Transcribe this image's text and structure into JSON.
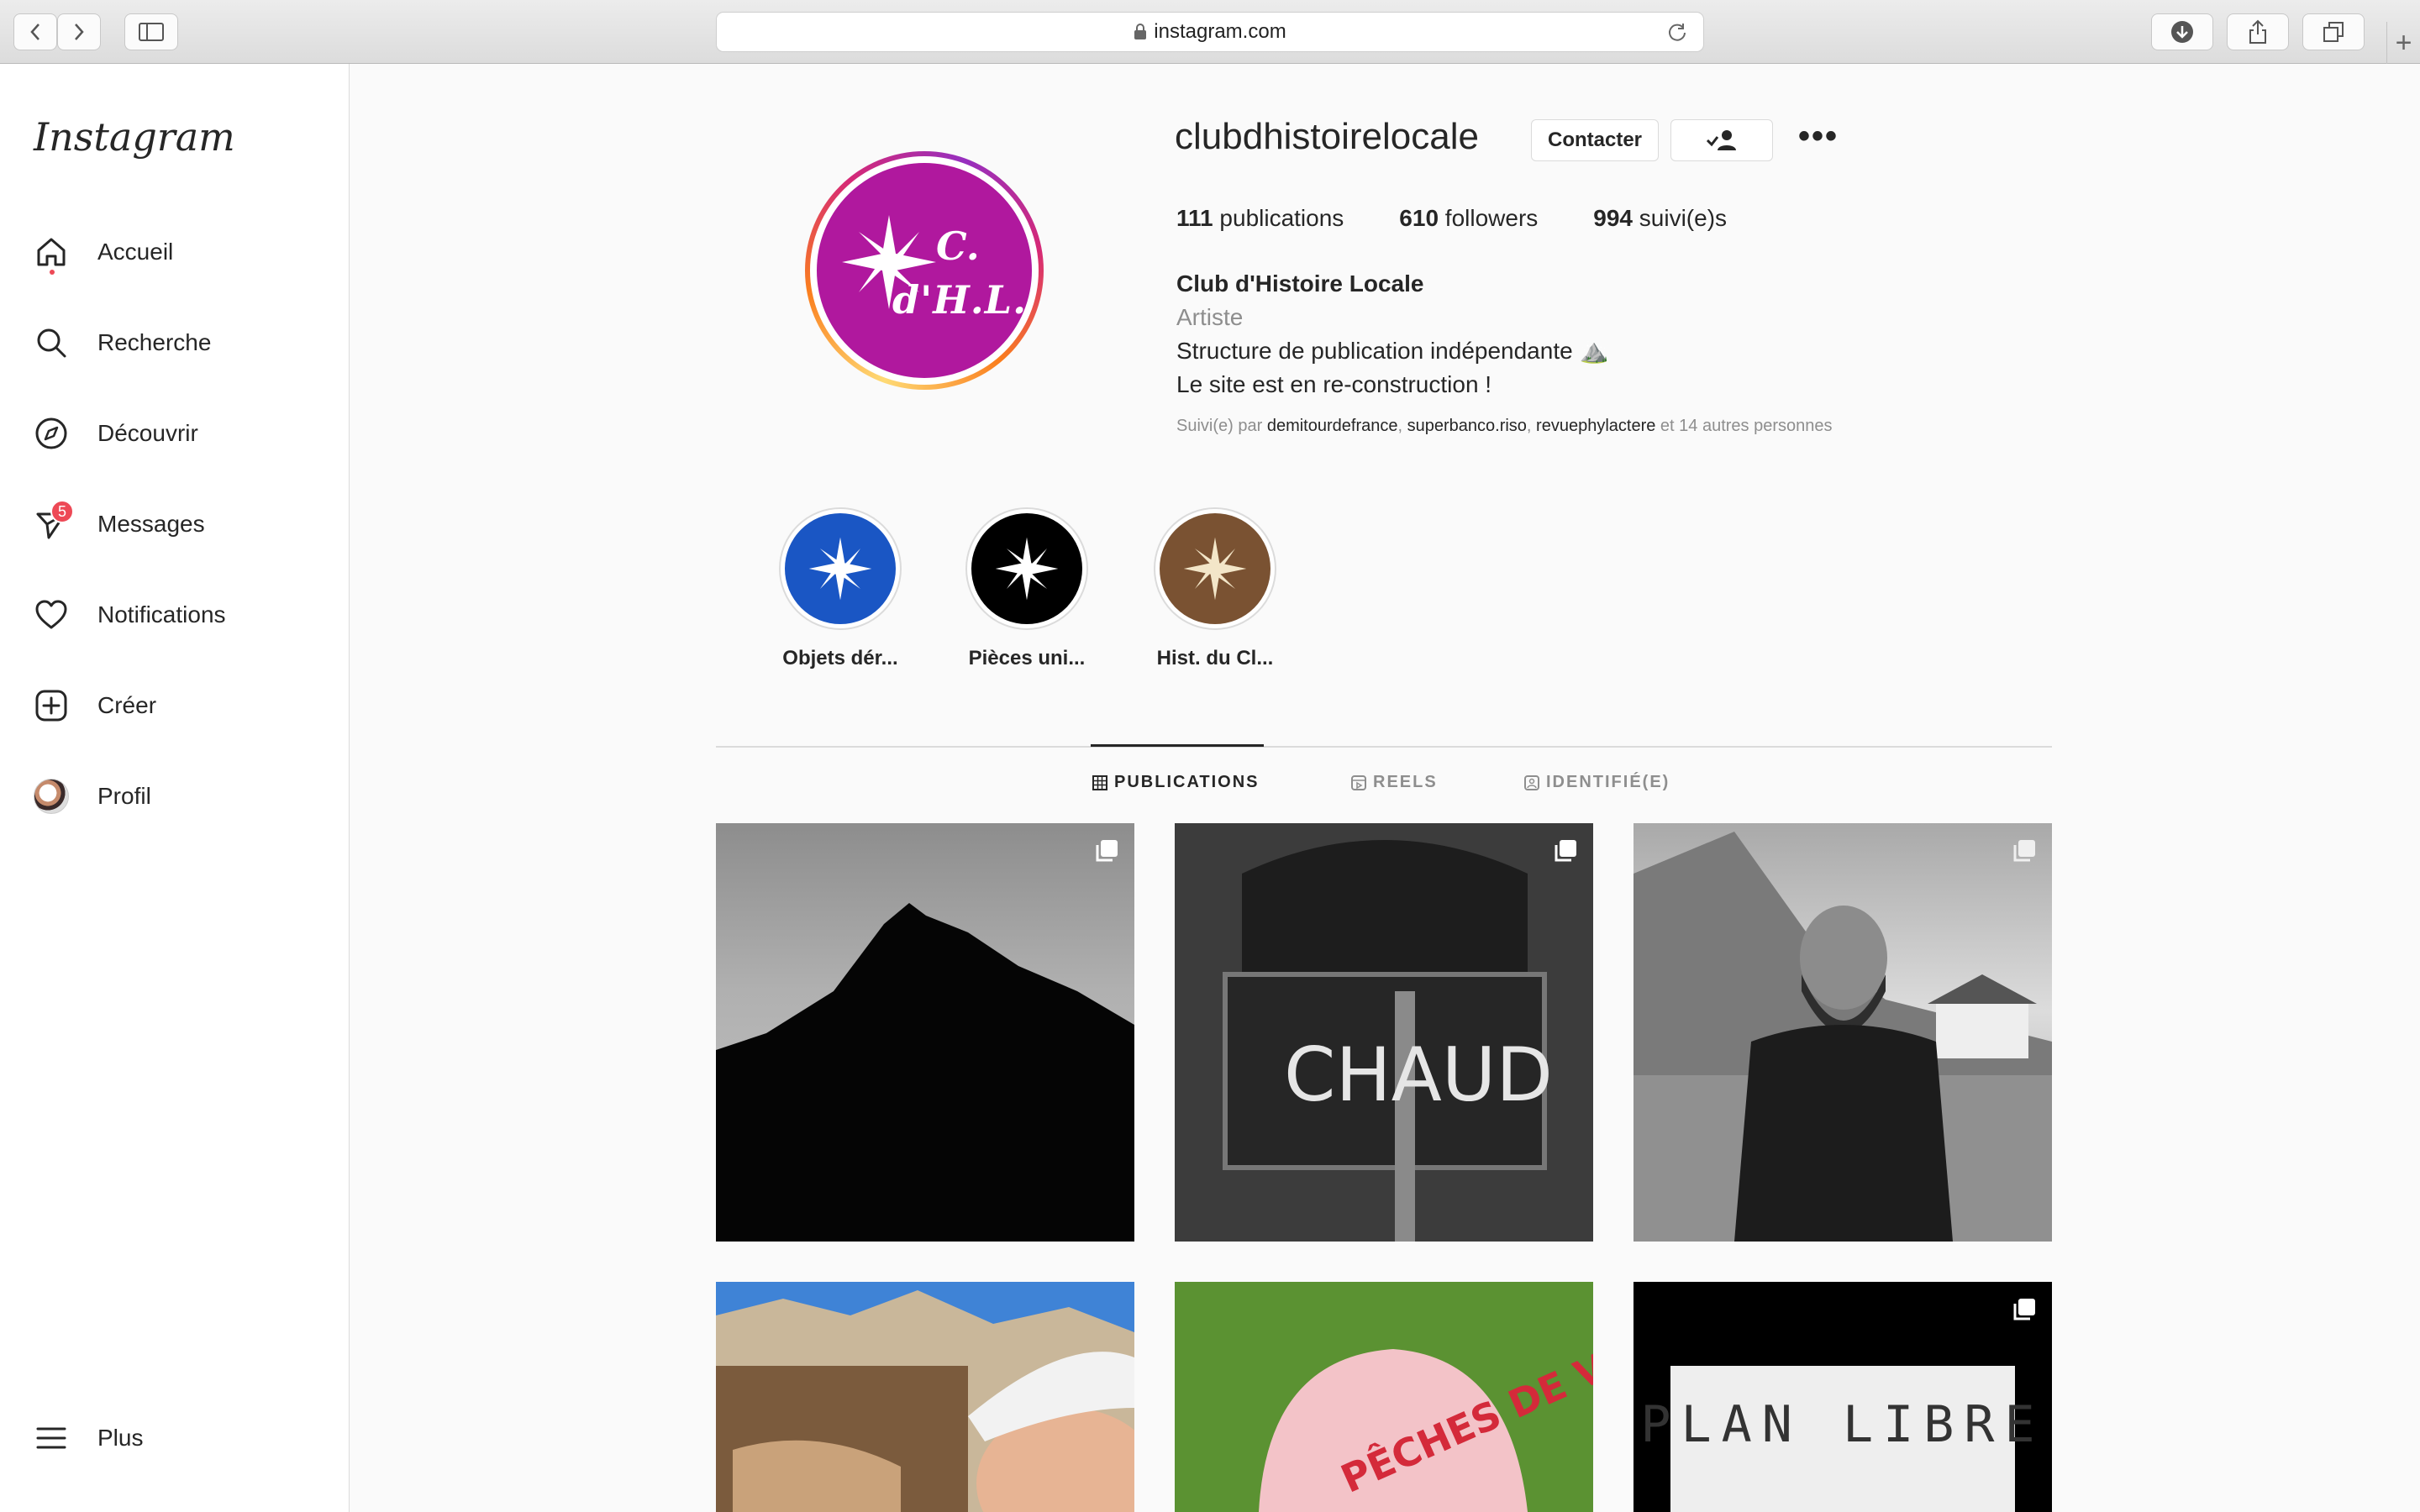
{
  "browser": {
    "url": "instagram.com"
  },
  "sidebar": {
    "logo": "Instagram",
    "items": [
      {
        "label": "Accueil",
        "icon": "home-icon"
      },
      {
        "label": "Recherche",
        "icon": "search-icon"
      },
      {
        "label": "Découvrir",
        "icon": "compass-icon"
      },
      {
        "label": "Messages",
        "icon": "messenger-icon",
        "badge": "5"
      },
      {
        "label": "Notifications",
        "icon": "heart-icon"
      },
      {
        "label": "Créer",
        "icon": "plus-square-icon"
      },
      {
        "label": "Profil",
        "icon": "avatar"
      }
    ],
    "more": "Plus"
  },
  "profile": {
    "username": "clubdhistoirelocale",
    "contact_button": "Contacter",
    "avatar_text_line1": "C.",
    "avatar_text_line2": "d'H.L.",
    "stats": {
      "posts_count": "111",
      "posts_label": "publications",
      "followers_count": "610",
      "followers_label": "followers",
      "following_count": "994",
      "following_label": "suivi(e)s"
    },
    "full_name": "Club d'Histoire Locale",
    "category": "Artiste",
    "bio_line1": "Structure de publication indépendante ⛰️",
    "bio_line2": "Le site est en re-construction !",
    "followed_by": {
      "prefix": "Suivi(e) par",
      "users": [
        "demitourdefrance",
        "superbanco.riso",
        "revuephylactere"
      ],
      "suffix": "et 14 autres personnes"
    }
  },
  "highlights": [
    {
      "label": "Objets dér...",
      "color": "#1a56c4"
    },
    {
      "label": "Pièces uni...",
      "color": "#000000"
    },
    {
      "label": "Hist. du Cl...",
      "color": "#7a5232"
    }
  ],
  "tabs": [
    {
      "label": "PUBLICATIONS",
      "active": true
    },
    {
      "label": "REELS",
      "active": false
    },
    {
      "label": "IDENTIFIÉ(E)",
      "active": false
    }
  ],
  "posts": [
    {
      "subject": "mountain silhouette",
      "multi": true
    },
    {
      "subject": "oven door chalk text",
      "text": "CHAUD",
      "multi": true
    },
    {
      "subject": "bearded man portrait",
      "multi": true
    },
    {
      "subject": "mountain firewood and cap",
      "multi": false
    },
    {
      "subject": "pink cap on grass",
      "text": "PÊCHES DE VILLE",
      "multi": false
    },
    {
      "subject": "dotted print sign",
      "text": "PLAN LIBRE",
      "multi": true
    }
  ],
  "colors": {
    "accent_pink": "#b0189e",
    "badge_red": "#ed4956"
  }
}
